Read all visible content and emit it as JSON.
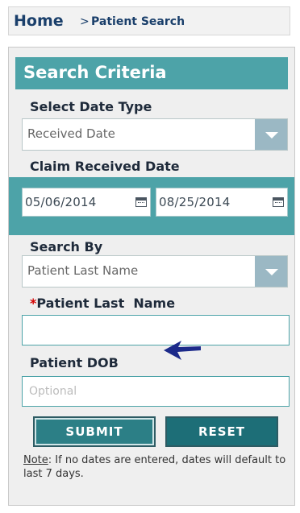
{
  "breadcrumb": {
    "home": "Home",
    "separator": ">",
    "current": "Patient Search"
  },
  "panel": {
    "title": "Search Criteria"
  },
  "date_type": {
    "label": "Select Date Type",
    "selected": "Received Date"
  },
  "claim_date": {
    "label": "Claim Received Date",
    "from": "05/06/2014",
    "to": "08/25/2014"
  },
  "search_by": {
    "label": "Search By",
    "selected": "Patient Last Name"
  },
  "last_name": {
    "required_mark": "*",
    "label": "Patient Last  Name",
    "value": ""
  },
  "dob": {
    "label": "Patient DOB",
    "placeholder": "Optional"
  },
  "buttons": {
    "submit": "SUBMIT",
    "reset": "RESET"
  },
  "note": {
    "label": "Note",
    "text": ": If no dates are entered, dates will default to last 7 days."
  },
  "colors": {
    "accent_teal": "#4da3a8",
    "button_teal": "#1f6f78",
    "navy_text": "#1a3f6b",
    "required_red": "#d40000",
    "pointer_arrow": "#1c2a8a"
  },
  "icons": {
    "dropdown": "chevron-down-icon",
    "calendar": "calendar-icon",
    "pointer": "arrow-pointer-icon"
  }
}
